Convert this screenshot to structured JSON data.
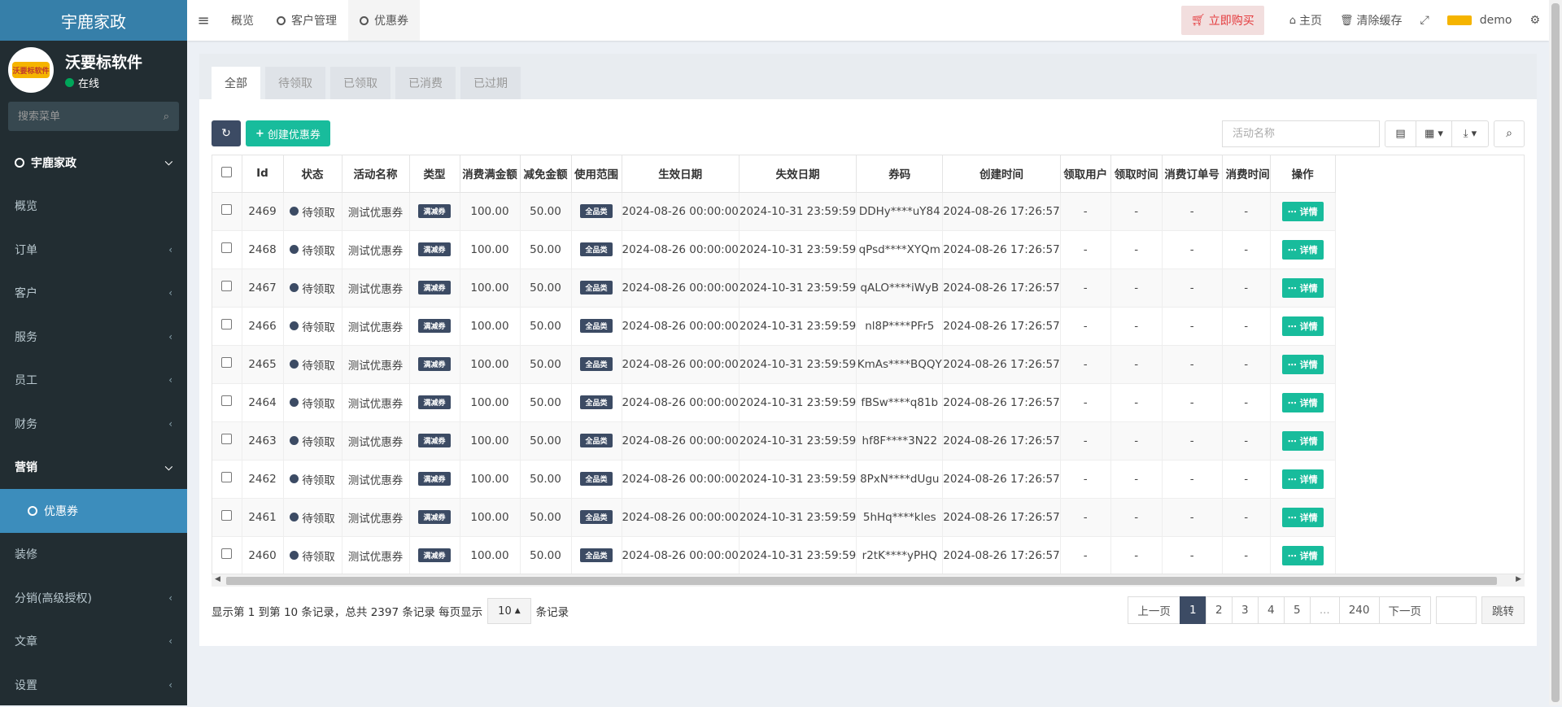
{
  "app": {
    "title": "宇鹿家政",
    "user_name": "沃要标软件",
    "user_status": "在线",
    "avatar_text": "沃要标软件"
  },
  "sidebar": {
    "search_placeholder": "搜索菜单",
    "items": [
      {
        "label": "宇鹿家政",
        "type": "head"
      },
      {
        "label": "概览"
      },
      {
        "label": "订单"
      },
      {
        "label": "客户"
      },
      {
        "label": "服务"
      },
      {
        "label": "员工"
      },
      {
        "label": "财务"
      },
      {
        "label": "营销",
        "type": "head"
      },
      {
        "label": "优惠券",
        "type": "sub"
      },
      {
        "label": "装修"
      },
      {
        "label": "分销(高级授权)"
      },
      {
        "label": "文章"
      },
      {
        "label": "设置"
      }
    ]
  },
  "topbar": {
    "tabs": [
      "概览",
      "客户管理",
      "优惠券"
    ],
    "buy_label": "立即购买",
    "home_label": "主页",
    "clear_cache_label": "清除缓存",
    "user_label": "demo"
  },
  "filter_tabs": [
    "全部",
    "待领取",
    "已领取",
    "已消费",
    "已过期"
  ],
  "toolbar": {
    "create_label": "创建优惠券",
    "search_placeholder": "活动名称"
  },
  "table": {
    "columns": [
      "Id",
      "状态",
      "活动名称",
      "类型",
      "消费满金额",
      "减免金额",
      "使用范围",
      "生效日期",
      "失效日期",
      "券码",
      "创建时间",
      "领取用户",
      "领取时间",
      "消费订单号",
      "消费时间",
      "操作"
    ],
    "rows": [
      {
        "id": "2469",
        "status": "待领取",
        "name": "测试优惠券",
        "type": "满减券",
        "min": "100.00",
        "off": "50.00",
        "scope": "全品类",
        "start": "2024-08-26 00:00:00",
        "end": "2024-10-31 23:59:59",
        "code": "DDHy****uY84",
        "created": "2024-08-26 17:26:57",
        "user": "-",
        "get_time": "-",
        "order": "-",
        "use_time": "-"
      },
      {
        "id": "2468",
        "status": "待领取",
        "name": "测试优惠券",
        "type": "满减券",
        "min": "100.00",
        "off": "50.00",
        "scope": "全品类",
        "start": "2024-08-26 00:00:00",
        "end": "2024-10-31 23:59:59",
        "code": "qPsd****XYQm",
        "created": "2024-08-26 17:26:57",
        "user": "-",
        "get_time": "-",
        "order": "-",
        "use_time": "-"
      },
      {
        "id": "2467",
        "status": "待领取",
        "name": "测试优惠券",
        "type": "满减券",
        "min": "100.00",
        "off": "50.00",
        "scope": "全品类",
        "start": "2024-08-26 00:00:00",
        "end": "2024-10-31 23:59:59",
        "code": "qALO****iWyB",
        "created": "2024-08-26 17:26:57",
        "user": "-",
        "get_time": "-",
        "order": "-",
        "use_time": "-"
      },
      {
        "id": "2466",
        "status": "待领取",
        "name": "测试优惠券",
        "type": "满减券",
        "min": "100.00",
        "off": "50.00",
        "scope": "全品类",
        "start": "2024-08-26 00:00:00",
        "end": "2024-10-31 23:59:59",
        "code": "nl8P****PFr5",
        "created": "2024-08-26 17:26:57",
        "user": "-",
        "get_time": "-",
        "order": "-",
        "use_time": "-"
      },
      {
        "id": "2465",
        "status": "待领取",
        "name": "测试优惠券",
        "type": "满减券",
        "min": "100.00",
        "off": "50.00",
        "scope": "全品类",
        "start": "2024-08-26 00:00:00",
        "end": "2024-10-31 23:59:59",
        "code": "KmAs****BQQY",
        "created": "2024-08-26 17:26:57",
        "user": "-",
        "get_time": "-",
        "order": "-",
        "use_time": "-"
      },
      {
        "id": "2464",
        "status": "待领取",
        "name": "测试优惠券",
        "type": "满减券",
        "min": "100.00",
        "off": "50.00",
        "scope": "全品类",
        "start": "2024-08-26 00:00:00",
        "end": "2024-10-31 23:59:59",
        "code": "fBSw****q81b",
        "created": "2024-08-26 17:26:57",
        "user": "-",
        "get_time": "-",
        "order": "-",
        "use_time": "-"
      },
      {
        "id": "2463",
        "status": "待领取",
        "name": "测试优惠券",
        "type": "满减券",
        "min": "100.00",
        "off": "50.00",
        "scope": "全品类",
        "start": "2024-08-26 00:00:00",
        "end": "2024-10-31 23:59:59",
        "code": "hf8F****3N22",
        "created": "2024-08-26 17:26:57",
        "user": "-",
        "get_time": "-",
        "order": "-",
        "use_time": "-"
      },
      {
        "id": "2462",
        "status": "待领取",
        "name": "测试优惠券",
        "type": "满减券",
        "min": "100.00",
        "off": "50.00",
        "scope": "全品类",
        "start": "2024-08-26 00:00:00",
        "end": "2024-10-31 23:59:59",
        "code": "8PxN****dUgu",
        "created": "2024-08-26 17:26:57",
        "user": "-",
        "get_time": "-",
        "order": "-",
        "use_time": "-"
      },
      {
        "id": "2461",
        "status": "待领取",
        "name": "测试优惠券",
        "type": "满减券",
        "min": "100.00",
        "off": "50.00",
        "scope": "全品类",
        "start": "2024-08-26 00:00:00",
        "end": "2024-10-31 23:59:59",
        "code": "5hHq****kles",
        "created": "2024-08-26 17:26:57",
        "user": "-",
        "get_time": "-",
        "order": "-",
        "use_time": "-"
      },
      {
        "id": "2460",
        "status": "待领取",
        "name": "测试优惠券",
        "type": "满减券",
        "min": "100.00",
        "off": "50.00",
        "scope": "全品类",
        "start": "2024-08-26 00:00:00",
        "end": "2024-10-31 23:59:59",
        "code": "r2tK****yPHQ",
        "created": "2024-08-26 17:26:57",
        "user": "-",
        "get_time": "-",
        "order": "-",
        "use_time": "-"
      }
    ],
    "detail_label": "详情"
  },
  "pagination": {
    "summary_before": "显示第 1 到第 10 条记录，总共 2397 条记录 每页显示",
    "page_size": "10",
    "summary_after": "条记录",
    "prev": "上一页",
    "pages": [
      "1",
      "2",
      "3",
      "4",
      "5",
      "...",
      "240"
    ],
    "current": "1",
    "next": "下一页",
    "go": "跳转"
  },
  "colors": {
    "sidebar_bg": "#222d32",
    "accent": "#3c8dbc",
    "primary_dark": "#3c4b64",
    "success": "#18bc9c",
    "danger": "#e4393c"
  },
  "icons": [
    "menu-icon",
    "cart-icon",
    "home-icon",
    "trash-icon",
    "fullscreen-icon",
    "gear-icon",
    "search-icon",
    "refresh-icon",
    "plus-icon",
    "columns-icon",
    "grid-icon",
    "export-icon",
    "ellipsis-icon"
  ]
}
